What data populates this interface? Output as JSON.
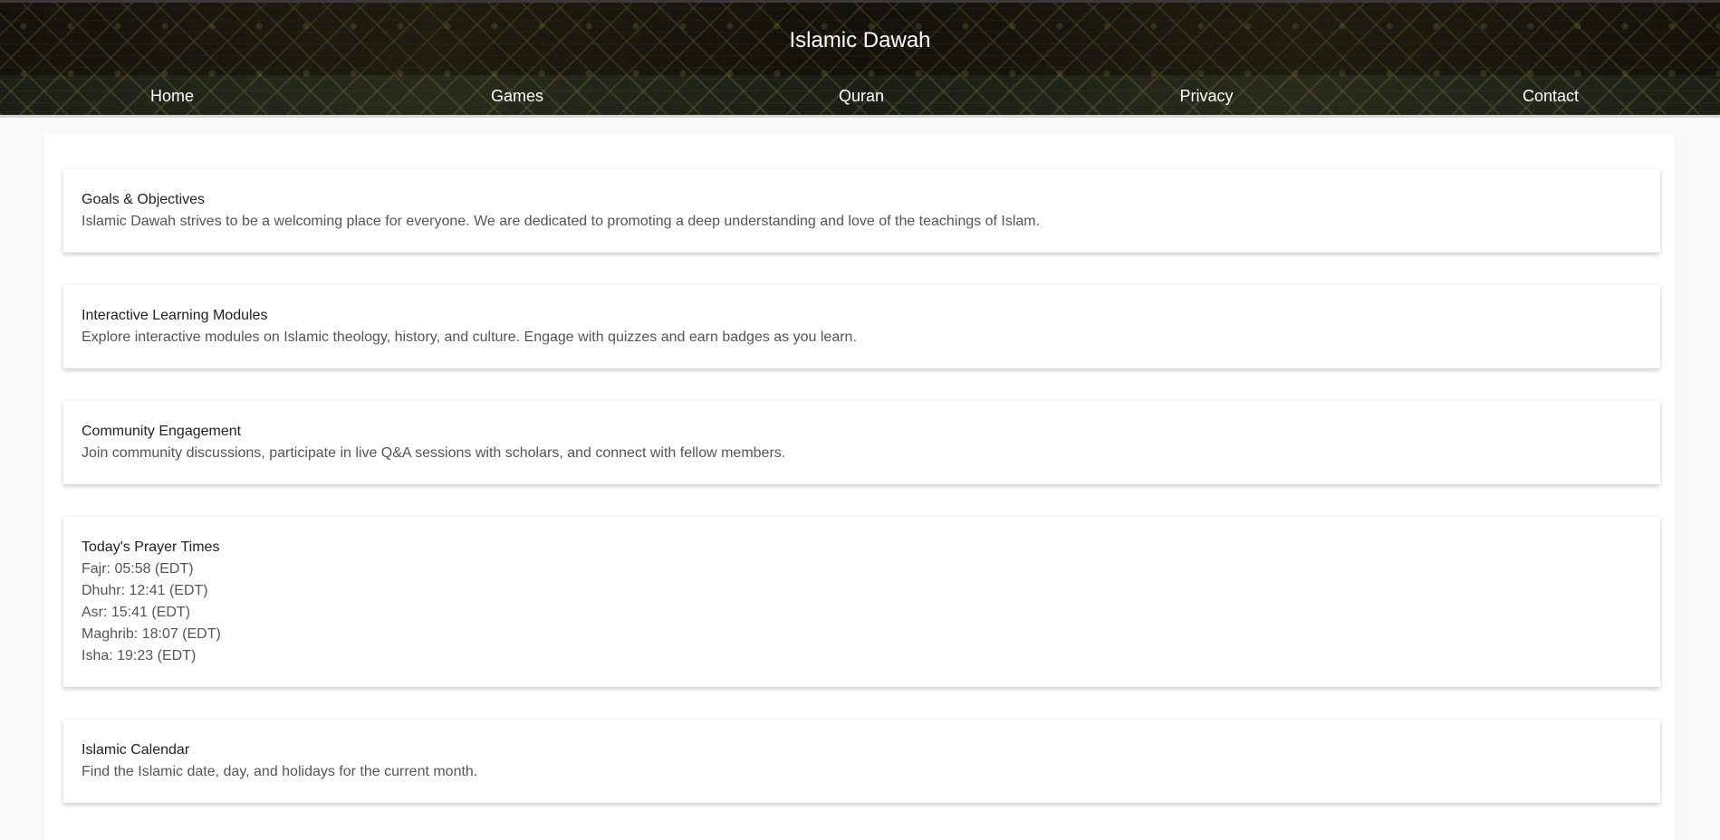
{
  "header": {
    "title": "Islamic Dawah"
  },
  "nav": {
    "items": [
      {
        "label": "Home"
      },
      {
        "label": "Games"
      },
      {
        "label": "Quran"
      },
      {
        "label": "Privacy"
      },
      {
        "label": "Contact"
      }
    ]
  },
  "sections": {
    "goals": {
      "title": "Goals & Objectives",
      "text": "Islamic Dawah strives to be a welcoming place for everyone. We are dedicated to promoting a deep understanding and love of the teachings of Islam."
    },
    "modules": {
      "title": "Interactive Learning Modules",
      "text": "Explore interactive modules on Islamic theology, history, and culture. Engage with quizzes and earn badges as you learn."
    },
    "community": {
      "title": "Community Engagement",
      "text": "Join community discussions, participate in live Q&A sessions with scholars, and connect with fellow members."
    },
    "prayer": {
      "title": "Today's Prayer Times",
      "times": [
        "Fajr: 05:58 (EDT)",
        "Dhuhr: 12:41 (EDT)",
        "Asr: 15:41 (EDT)",
        "Maghrib: 18:07 (EDT)",
        "Isha: 19:23 (EDT)"
      ]
    },
    "calendar": {
      "title": "Islamic Calendar",
      "text": "Find the Islamic date, day, and holidays for the current month."
    }
  }
}
